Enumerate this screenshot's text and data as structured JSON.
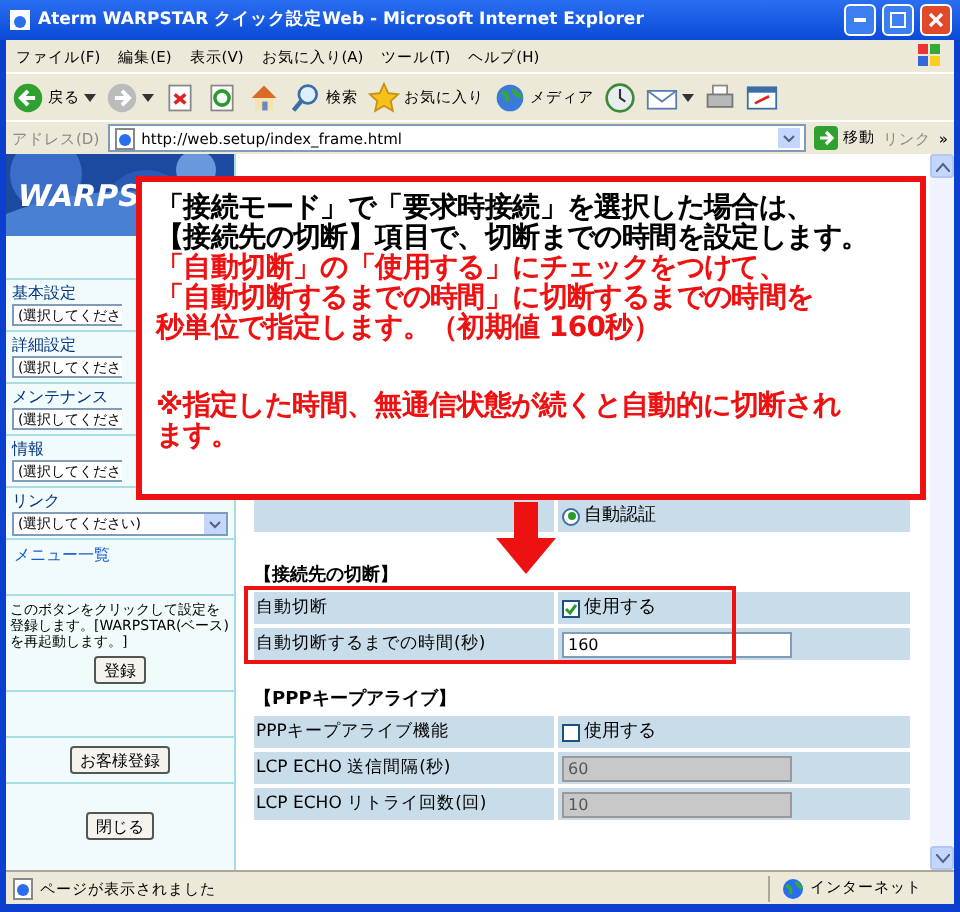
{
  "window": {
    "title": "Aterm WARPSTAR クイック設定Web - Microsoft Internet Explorer"
  },
  "menu": [
    "ファイル(F)",
    "編集(E)",
    "表示(V)",
    "お気に入り(A)",
    "ツール(T)",
    "ヘルプ(H)"
  ],
  "toolbar": [
    {
      "kind": "back",
      "label": "戻る"
    },
    {
      "kind": "forward"
    },
    {
      "kind": "stop"
    },
    {
      "kind": "refresh"
    },
    {
      "kind": "home"
    },
    {
      "kind": "search",
      "label": "検索"
    },
    {
      "kind": "favorites",
      "label": "お気に入り"
    },
    {
      "kind": "media",
      "label": "メディア"
    },
    {
      "kind": "history"
    },
    {
      "kind": "mail"
    },
    {
      "kind": "print"
    },
    {
      "kind": "edit"
    }
  ],
  "address": {
    "label": "アドレス(D)",
    "url": "http://web.setup/index_frame.html",
    "go": "移動",
    "links": "リンク",
    "more": "»"
  },
  "sidebar": {
    "logo": "WARPS",
    "sections": [
      {
        "title": "基本設定",
        "select": "(選択してくださ"
      },
      {
        "title": "詳細設定",
        "select": "(選択してくださ"
      },
      {
        "title": "メンテナンス",
        "select": "(選択してくださ"
      },
      {
        "title": "情報",
        "select": "(選択してくださ"
      },
      {
        "title": "リンク",
        "select": "(選択してください)"
      }
    ],
    "menu_link": "メニュー一覧",
    "note": "このボタンをクリックして設定を登録します。[WARPSTAR(ベース)を再起動します。]",
    "register": "登録",
    "customer": "お客様登録",
    "close": "閉じる"
  },
  "main": {
    "auth_option": {
      "label": "自動認証",
      "selected": true
    },
    "sections": [
      {
        "title": "【接続先の切断】",
        "highlighted": true,
        "rows": [
          {
            "label": "自動切断",
            "kind": "checkbox",
            "text": "使用する",
            "checked": true
          },
          {
            "label": "自動切断するまでの時間(秒)",
            "kind": "input",
            "value": "160",
            "disabled": false
          }
        ]
      },
      {
        "title": "【PPPキープアライブ】",
        "highlighted": false,
        "rows": [
          {
            "label": "PPPキープアライブ機能",
            "kind": "checkbox",
            "text": "使用する",
            "checked": false
          },
          {
            "label": "LCP ECHO 送信間隔(秒)",
            "kind": "input",
            "value": "60",
            "disabled": true
          },
          {
            "label": "LCP ECHO リトライ回数(回)",
            "kind": "input",
            "value": "10",
            "disabled": true
          }
        ]
      }
    ]
  },
  "callout": {
    "blocks": [
      [
        {
          "color": "#000000",
          "lines": [
            "「接続モード」で「要求時接続」を選択した場合は、",
            "【接続先の切断】項目で、切断までの時間を設定します。"
          ]
        },
        {
          "color": "#ee1111",
          "lines": [
            "「自動切断」の「使用する」にチェックをつけて、",
            "「自動切断するまでの時間」に切断するまでの時間を",
            "秒単位で指定します。（初期値 160秒）"
          ]
        }
      ],
      [
        {
          "color": "#ee1111",
          "lines": [
            "※指定した時間、無通信状態が続くと自動的に切断され",
            "ます。"
          ]
        }
      ]
    ]
  },
  "status": {
    "text": "ページが表示されました",
    "zone": "インターネット"
  }
}
